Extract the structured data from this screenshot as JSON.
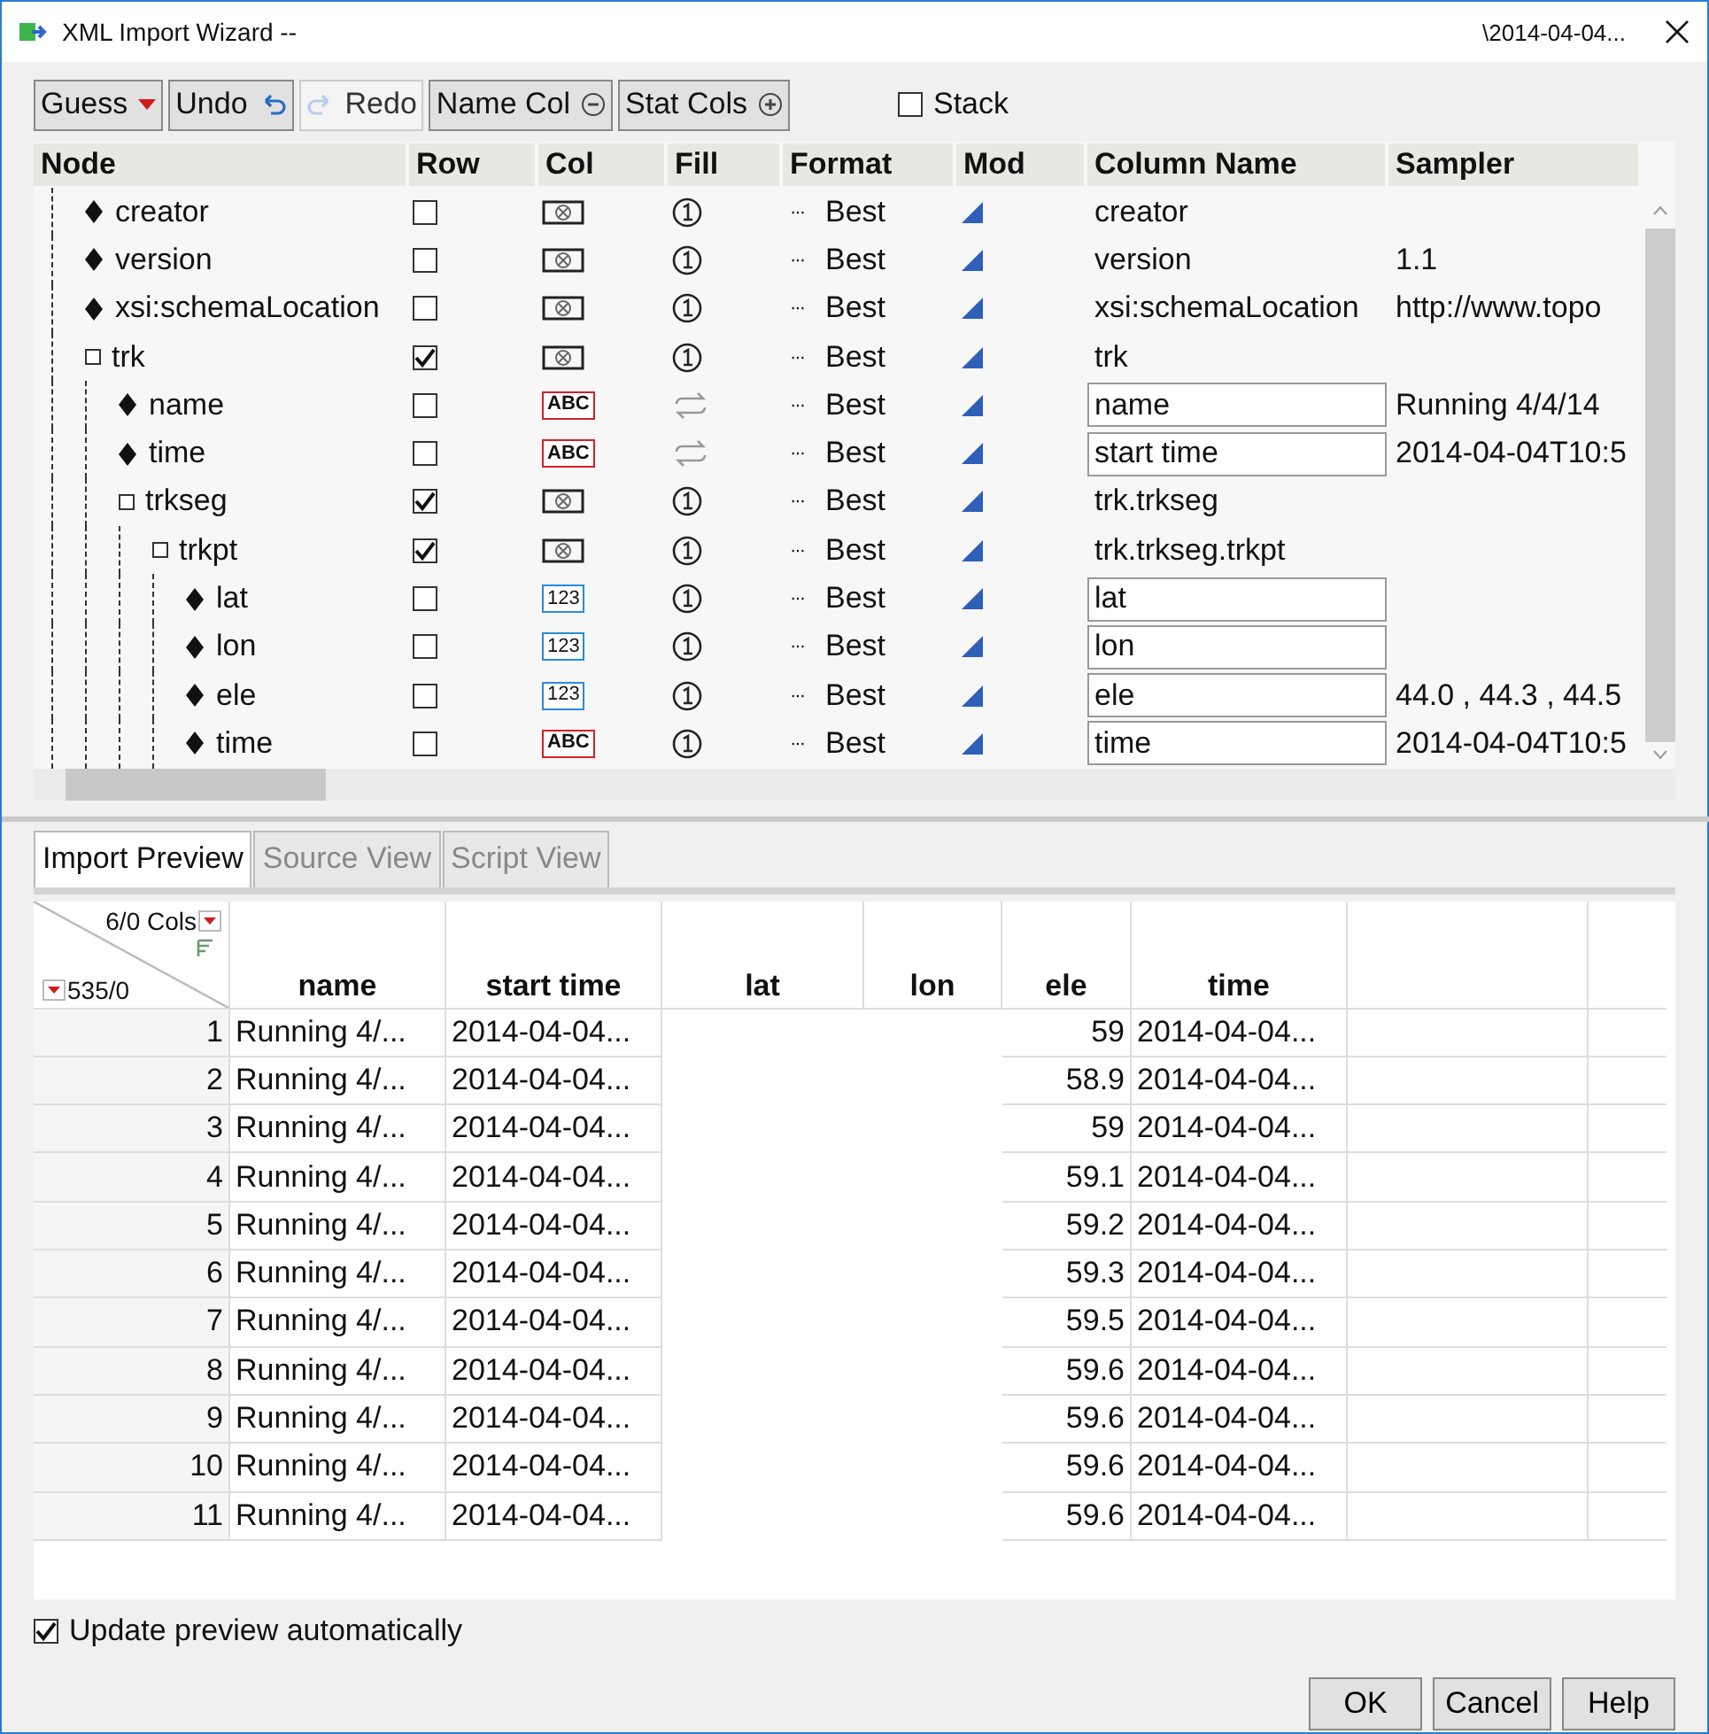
{
  "window": {
    "title": "XML Import Wizard --",
    "file": "\\2014-04-04..."
  },
  "toolbar": {
    "buttons": [
      {
        "label": "Guess",
        "disabled": false
      },
      {
        "label": "Undo",
        "disabled": false
      },
      {
        "label": "Redo",
        "disabled": true
      },
      {
        "label": "Name Col",
        "disabled": false
      },
      {
        "label": "Stat Cols",
        "disabled": false
      }
    ],
    "stack": {
      "label": "Stack",
      "checked": false
    }
  },
  "tree": {
    "columns": [
      "Node",
      "Row",
      "Col",
      "Fill",
      "Format",
      "Mod",
      "Column Name",
      "Sampler"
    ],
    "format_button": "···",
    "nodes": [
      {
        "label": "creator",
        "kind": "leaf",
        "row_checked": false,
        "col": {
          "kind": "empty"
        },
        "fill": {
          "kind": "once"
        },
        "format": "Best",
        "column_name": "creator",
        "editable": false
      },
      {
        "label": "version",
        "kind": "leaf",
        "row_checked": false,
        "col": {
          "kind": "empty"
        },
        "fill": {
          "kind": "once"
        },
        "format": "Best",
        "column_name": "version",
        "editable": false,
        "sampler": "1.1"
      },
      {
        "label": "xsi:schemaLocation",
        "kind": "leaf",
        "row_checked": false,
        "col": {
          "kind": "empty"
        },
        "fill": {
          "kind": "once"
        },
        "format": "Best",
        "column_name": "xsi:schemaLocation",
        "editable": false,
        "sampler": "http://www.topo"
      },
      {
        "label": "trk",
        "kind": "group",
        "row_checked": true,
        "col": {
          "kind": "empty"
        },
        "fill": {
          "kind": "once"
        },
        "format": "Best",
        "column_name": "trk",
        "editable": false,
        "children": [
          {
            "label": "name",
            "kind": "leaf",
            "row_checked": false,
            "col": {
              "kind": "char",
              "text": "ABC"
            },
            "fill": {
              "kind": "repeat"
            },
            "format": "Best",
            "column_name": "name",
            "editable": true,
            "sampler": "Running 4/4/14"
          },
          {
            "label": "time",
            "kind": "leaf",
            "row_checked": false,
            "col": {
              "kind": "char",
              "text": "ABC"
            },
            "fill": {
              "kind": "repeat"
            },
            "format": "Best",
            "column_name": "start time",
            "editable": true,
            "sampler": "2014-04-04T10:5"
          },
          {
            "label": "trkseg",
            "kind": "group",
            "row_checked": true,
            "col": {
              "kind": "empty"
            },
            "fill": {
              "kind": "once"
            },
            "format": "Best",
            "column_name": "trk.trkseg",
            "editable": false,
            "children": [
              {
                "label": "trkpt",
                "kind": "group",
                "row_checked": true,
                "col": {
                  "kind": "empty"
                },
                "fill": {
                  "kind": "once"
                },
                "format": "Best",
                "column_name": "trk.trkseg.trkpt",
                "editable": false,
                "children": [
                  {
                    "label": "lat",
                    "kind": "leaf",
                    "row_checked": false,
                    "col": {
                      "kind": "num",
                      "text": "123"
                    },
                    "fill": {
                      "kind": "once"
                    },
                    "format": "Best",
                    "column_name": "lat",
                    "editable": true
                  },
                  {
                    "label": "lon",
                    "kind": "leaf",
                    "row_checked": false,
                    "col": {
                      "kind": "num",
                      "text": "123"
                    },
                    "fill": {
                      "kind": "once"
                    },
                    "format": "Best",
                    "column_name": "lon",
                    "editable": true
                  },
                  {
                    "label": "ele",
                    "kind": "leaf",
                    "row_checked": false,
                    "col": {
                      "kind": "num",
                      "text": "123"
                    },
                    "fill": {
                      "kind": "once"
                    },
                    "format": "Best",
                    "column_name": "ele",
                    "editable": true,
                    "sampler": "44.0 , 44.3 , 44.5"
                  },
                  {
                    "label": "time",
                    "kind": "leaf",
                    "row_checked": false,
                    "col": {
                      "kind": "char",
                      "text": "ABC"
                    },
                    "fill": {
                      "kind": "once"
                    },
                    "format": "Best",
                    "column_name": "time",
                    "editable": true,
                    "sampler": "2014-04-04T10:5"
                  }
                ]
              }
            ]
          }
        ]
      }
    ]
  },
  "tabs": [
    {
      "label": "Import Preview",
      "selected": true
    },
    {
      "label": "Source View",
      "selected": false
    },
    {
      "label": "Script View",
      "selected": false
    }
  ],
  "preview": {
    "cols_count": "6/0 Cols",
    "rows_count": "535/0",
    "columns": [
      "name",
      "start time",
      "lat",
      "lon",
      "ele",
      "time"
    ],
    "rows": [
      {
        "number": "1",
        "name": "Running 4/...",
        "start_time": "2014-04-04...",
        "ele": "59",
        "time": "2014-04-04..."
      },
      {
        "number": "2",
        "name": "Running 4/...",
        "start_time": "2014-04-04...",
        "ele": "58.9",
        "time": "2014-04-04..."
      },
      {
        "number": "3",
        "name": "Running 4/...",
        "start_time": "2014-04-04...",
        "ele": "59",
        "time": "2014-04-04..."
      },
      {
        "number": "4",
        "name": "Running 4/...",
        "start_time": "2014-04-04...",
        "ele": "59.1",
        "time": "2014-04-04..."
      },
      {
        "number": "5",
        "name": "Running 4/...",
        "start_time": "2014-04-04...",
        "ele": "59.2",
        "time": "2014-04-04..."
      },
      {
        "number": "6",
        "name": "Running 4/...",
        "start_time": "2014-04-04...",
        "ele": "59.3",
        "time": "2014-04-04..."
      },
      {
        "number": "7",
        "name": "Running 4/...",
        "start_time": "2014-04-04...",
        "ele": "59.5",
        "time": "2014-04-04..."
      },
      {
        "number": "8",
        "name": "Running 4/...",
        "start_time": "2014-04-04...",
        "ele": "59.6",
        "time": "2014-04-04..."
      },
      {
        "number": "9",
        "name": "Running 4/...",
        "start_time": "2014-04-04...",
        "ele": "59.6",
        "time": "2014-04-04..."
      },
      {
        "number": "10",
        "name": "Running 4/...",
        "start_time": "2014-04-04...",
        "ele": "59.6",
        "time": "2014-04-04..."
      },
      {
        "number": "11",
        "name": "Running 4/...",
        "start_time": "2014-04-04...",
        "ele": "59.6",
        "time": "2014-04-04..."
      }
    ]
  },
  "update_preview": {
    "label": "Update preview automatically",
    "checked": true
  },
  "buttons": [
    "OK",
    "Cancel",
    "Help"
  ]
}
